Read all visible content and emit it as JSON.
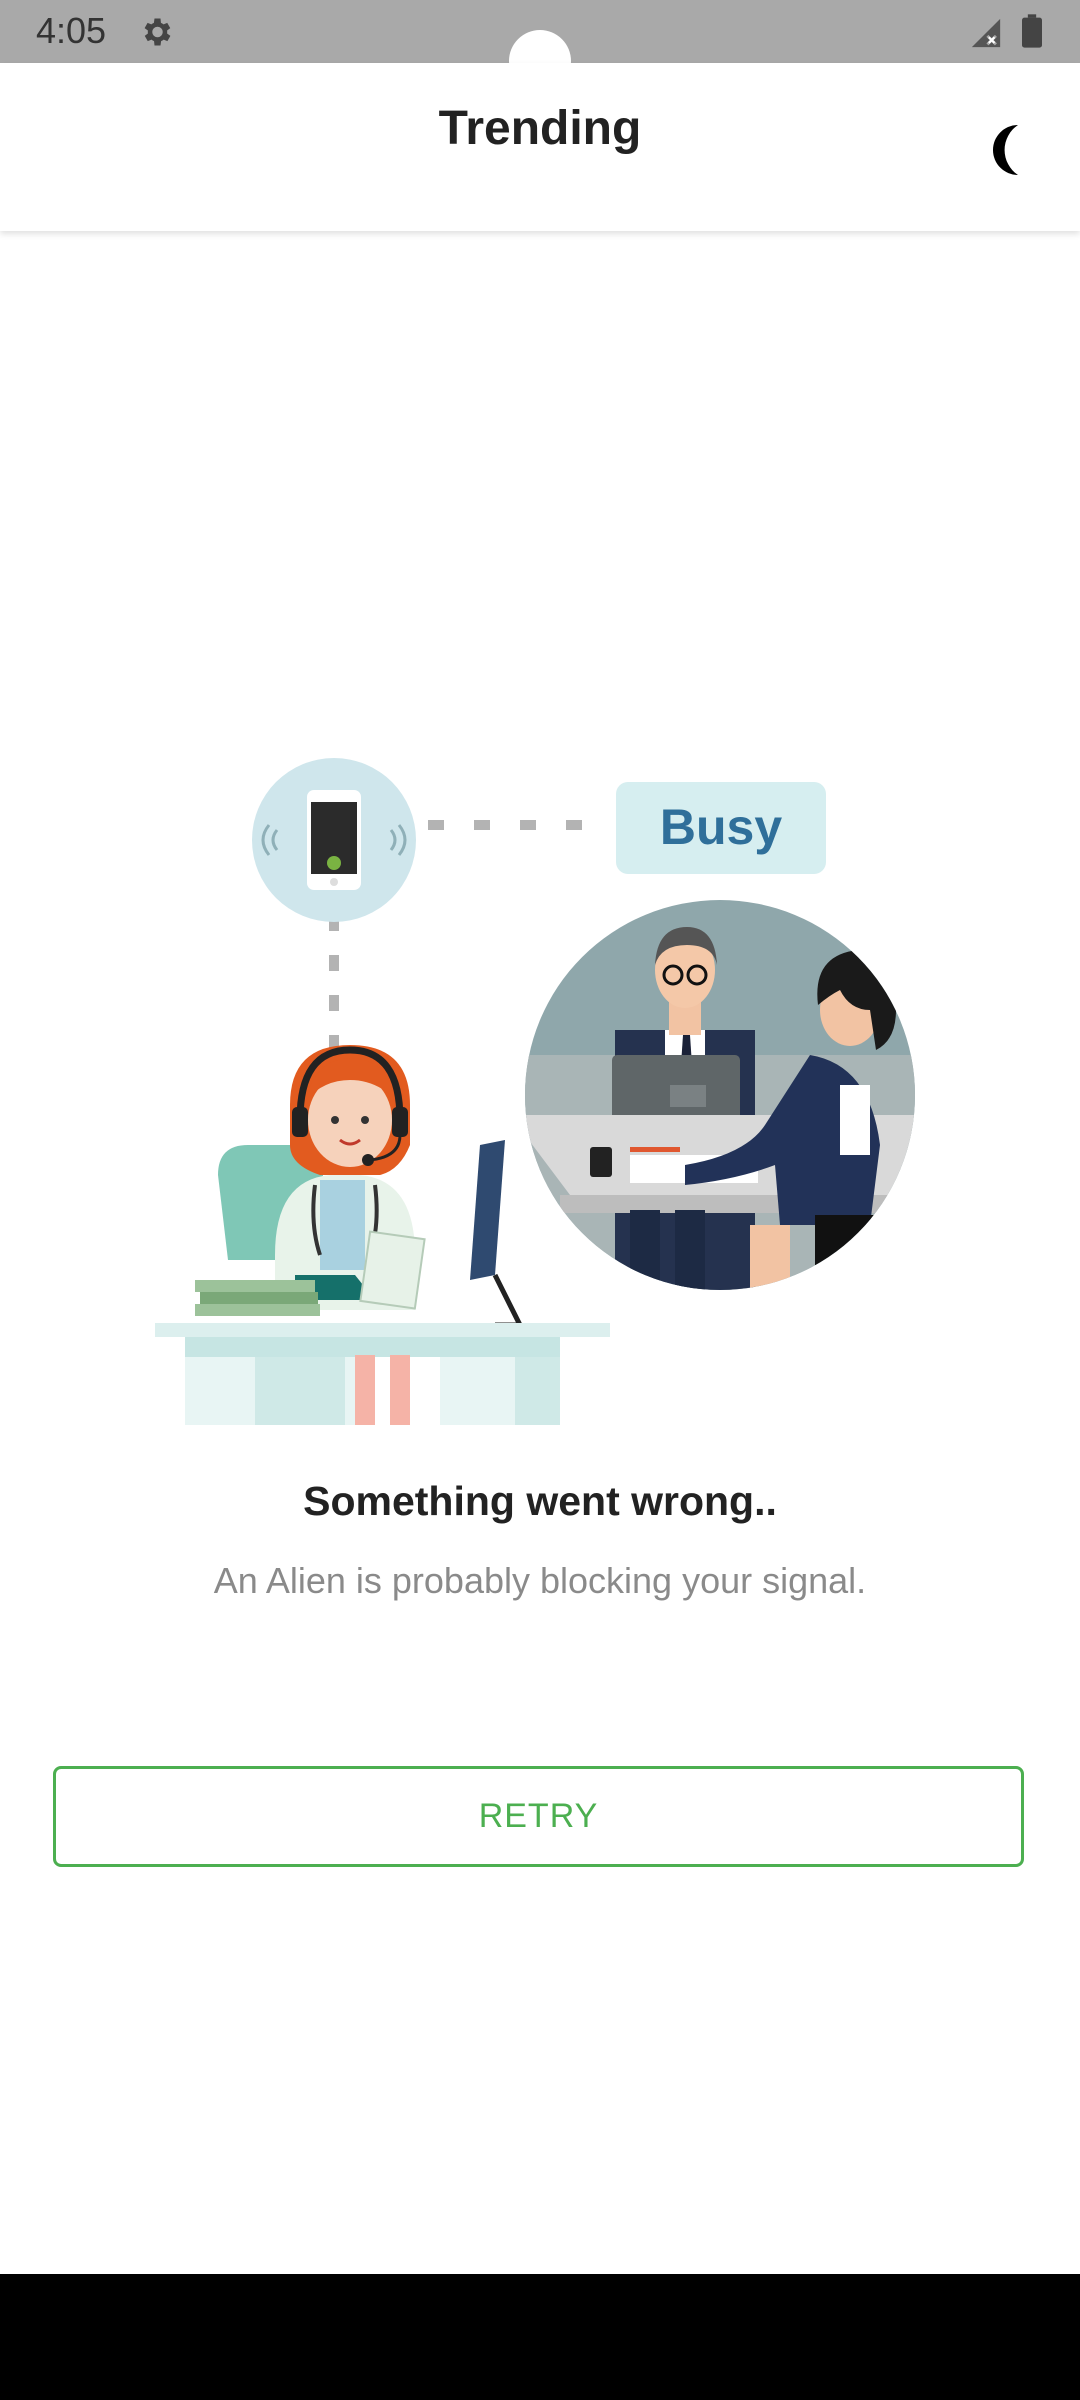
{
  "status_bar": {
    "time": "4:05",
    "settings_icon": "gear-icon",
    "signal_icon": "signal-no-data-icon",
    "battery_icon": "battery-icon"
  },
  "app_bar": {
    "title": "Trending",
    "theme_toggle_icon": "moon-icon"
  },
  "illustration": {
    "badge_text": "Busy",
    "accent_color": "#2f6f9a"
  },
  "error": {
    "title": "Something went wrong..",
    "message": "An Alien is probably blocking your signal."
  },
  "retry": {
    "label": "RETRY",
    "color": "#4caf50"
  }
}
